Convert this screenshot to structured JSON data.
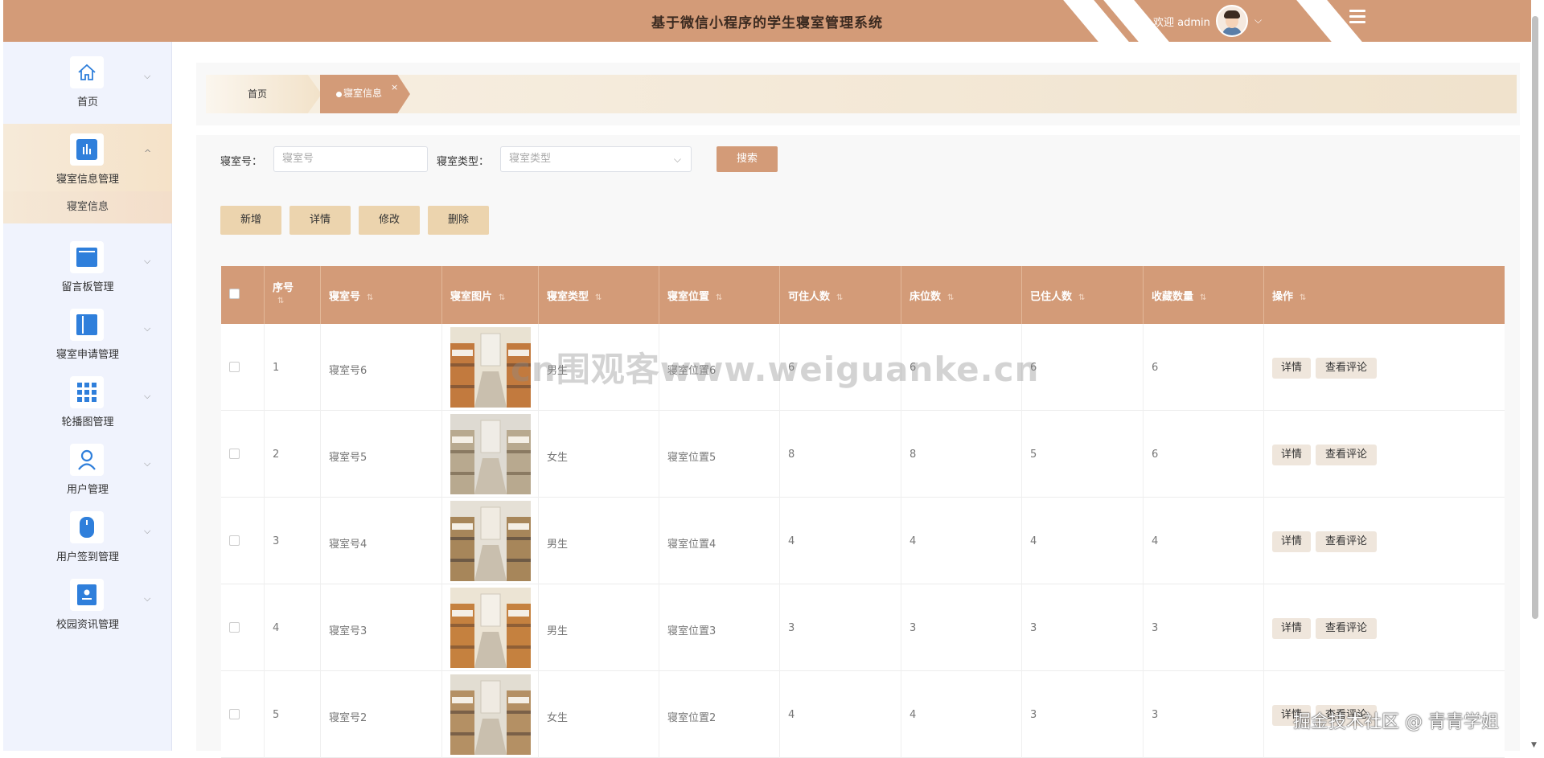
{
  "header": {
    "title": "基于微信小程序的学生寝室管理系统",
    "welcome": "欢迎 admin",
    "caret": "⌵"
  },
  "breadcrumb": {
    "home": "首页",
    "current": "寝室信息",
    "close": "×"
  },
  "sidebar": {
    "items": [
      {
        "label": "首页",
        "icon": "home-icon"
      },
      {
        "label": "寝室信息管理",
        "icon": "bar-chart-icon",
        "sub": "寝室信息"
      },
      {
        "label": "留言板管理",
        "icon": "board-icon"
      },
      {
        "label": "寝室申请管理",
        "icon": "book-icon"
      },
      {
        "label": "轮播图管理",
        "icon": "grid-icon"
      },
      {
        "label": "用户管理",
        "icon": "user-icon"
      },
      {
        "label": "用户签到管理",
        "icon": "mouse-icon"
      },
      {
        "label": "校园资讯管理",
        "icon": "id-card-icon"
      }
    ],
    "arrow_down": "⌵",
    "arrow_up": "^"
  },
  "search": {
    "room_label": "寝室号：",
    "room_placeholder": "寝室号",
    "type_label": "寝室类型：",
    "type_placeholder": "寝室类型",
    "button": "搜索"
  },
  "actions": {
    "add": "新增",
    "detail": "详情",
    "edit": "修改",
    "delete": "删除"
  },
  "table": {
    "headers": [
      "序号",
      "寝室号",
      "寝室图片",
      "寝室类型",
      "寝室位置",
      "可住人数",
      "床位数",
      "已住人数",
      "收藏数量",
      "操作"
    ],
    "sort_icon": "⇅",
    "rows": [
      {
        "index": "1",
        "room": "寝室号6",
        "type": "男生",
        "location": "寝室位置6",
        "capacity": "6",
        "beds": "6",
        "occupied": "6",
        "favorites": "6"
      },
      {
        "index": "2",
        "room": "寝室号5",
        "type": "女生",
        "location": "寝室位置5",
        "capacity": "8",
        "beds": "8",
        "occupied": "5",
        "favorites": "6"
      },
      {
        "index": "3",
        "room": "寝室号4",
        "type": "男生",
        "location": "寝室位置4",
        "capacity": "4",
        "beds": "4",
        "occupied": "4",
        "favorites": "4"
      },
      {
        "index": "4",
        "room": "寝室号3",
        "type": "男生",
        "location": "寝室位置3",
        "capacity": "3",
        "beds": "3",
        "occupied": "3",
        "favorites": "3"
      },
      {
        "index": "5",
        "room": "寝室号2",
        "type": "女生",
        "location": "寝室位置2",
        "capacity": "4",
        "beds": "4",
        "occupied": "3",
        "favorites": "3"
      }
    ],
    "op_detail": "详情",
    "op_comments": "查看评论"
  },
  "overlay": {
    "watermark": "cn围观客www.weiguanke.cn",
    "credit": "掘金技术社区 @ 青青学姐"
  },
  "colors": {
    "accent": "#d39b78",
    "button": "#ecd4ae",
    "sidebar": "#f0f3fd",
    "icon_blue": "#2f7fdb"
  }
}
